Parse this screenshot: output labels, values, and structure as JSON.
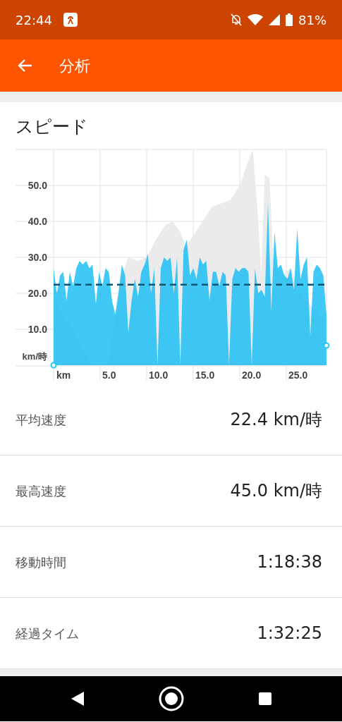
{
  "status_bar": {
    "time": "22:44",
    "battery": "81%"
  },
  "app_bar": {
    "title": "分析"
  },
  "section": {
    "title": "スピード"
  },
  "chart": {
    "y_unit": "km/時",
    "x_unit": "km",
    "yticks": [
      "50.0",
      "40.0",
      "30.0",
      "20.0",
      "10.0"
    ],
    "xticks": [
      "5.0",
      "10.0",
      "15.0",
      "20.0",
      "25.0"
    ]
  },
  "stats": [
    {
      "label": "平均速度",
      "value": "22.4 km/時"
    },
    {
      "label": "最高速度",
      "value": "45.0 km/時"
    },
    {
      "label": "移動時間",
      "value": "1:18:38"
    },
    {
      "label": "経過タイム",
      "value": "1:32:25"
    }
  ]
}
